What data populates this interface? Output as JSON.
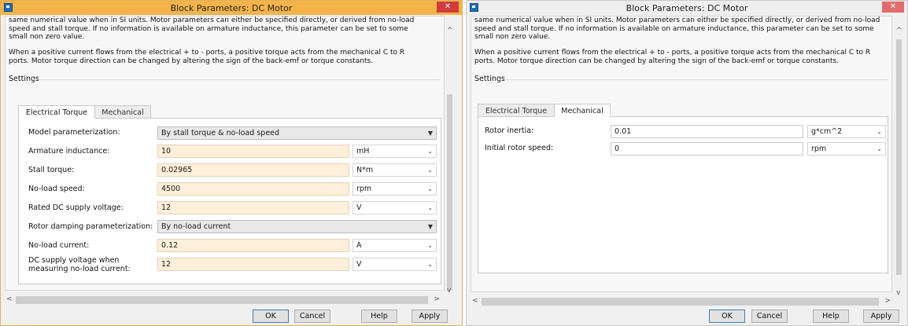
{
  "left": {
    "title": "Block Parameters: DC Motor",
    "description_top": [
      "same numerical value when in SI units. Motor parameters can either be specified directly, or derived from no-load",
      "speed and stall torque. If no information is available on armature inductance, this parameter can be set to some",
      "small non zero value."
    ],
    "description_bottom": [
      "When a positive current flows from the electrical + to - ports, a positive torque acts from the mechanical C to R",
      "ports. Motor torque direction can be changed by altering the sign of the back-emf or torque constants."
    ],
    "settings_label": "Settings",
    "tabs": [
      "Electrical Torque",
      "Mechanical"
    ],
    "active_tab": "Electrical Torque",
    "rows": [
      {
        "label": "Model parameterization:",
        "value": "By stall torque & no-load speed",
        "type": "select"
      },
      {
        "label": "Armature inductance:",
        "value": "10",
        "unit": "mH"
      },
      {
        "label": "Stall torque:",
        "value": "0.02965",
        "unit": "N*m"
      },
      {
        "label": "No-load speed:",
        "value": "4500",
        "unit": "rpm"
      },
      {
        "label": "Rated DC supply voltage:",
        "value": "12",
        "unit": "V"
      },
      {
        "label": "Rotor damping parameterization:",
        "value": "By no-load current",
        "type": "select"
      },
      {
        "label": "No-load current:",
        "value": "0.12",
        "unit": "A"
      },
      {
        "label": "DC supply voltage when",
        "label2": "measuring no-load current:",
        "value": "12",
        "unit": "V"
      }
    ],
    "buttons": {
      "ok": "OK",
      "cancel": "Cancel",
      "help": "Help",
      "apply": "Apply"
    }
  },
  "right": {
    "title": "Block Parameters: DC Motor",
    "description_top": [
      "same numerical value when in SI units. Motor parameters can either be specified directly, or derived from no-load",
      "speed and stall torque. If no information is available on armature inductance, this parameter can be set to some",
      "small non zero value."
    ],
    "description_bottom": [
      "When a positive current flows from the electrical + to - ports, a positive torque acts from the mechanical C to R",
      "ports. Motor torque direction can be changed by altering the sign of the back-emf or torque constants."
    ],
    "settings_label": "Settings",
    "tabs": [
      "Electrical Torque",
      "Mechanical"
    ],
    "active_tab": "Mechanical",
    "rows": [
      {
        "label": "Rotor inertia:",
        "value": "0.01",
        "unit": "g*cm^2"
      },
      {
        "label": "Initial rotor speed:",
        "value": "0",
        "unit": "rpm"
      }
    ],
    "buttons": {
      "ok": "OK",
      "cancel": "Cancel",
      "help": "Help",
      "apply": "Apply"
    }
  },
  "icons": {
    "close": "✕",
    "caret": "⌄",
    "select_caret": "▼",
    "scroll_up": "^",
    "scroll_down": "v",
    "scroll_left": "<",
    "scroll_right": ">"
  }
}
